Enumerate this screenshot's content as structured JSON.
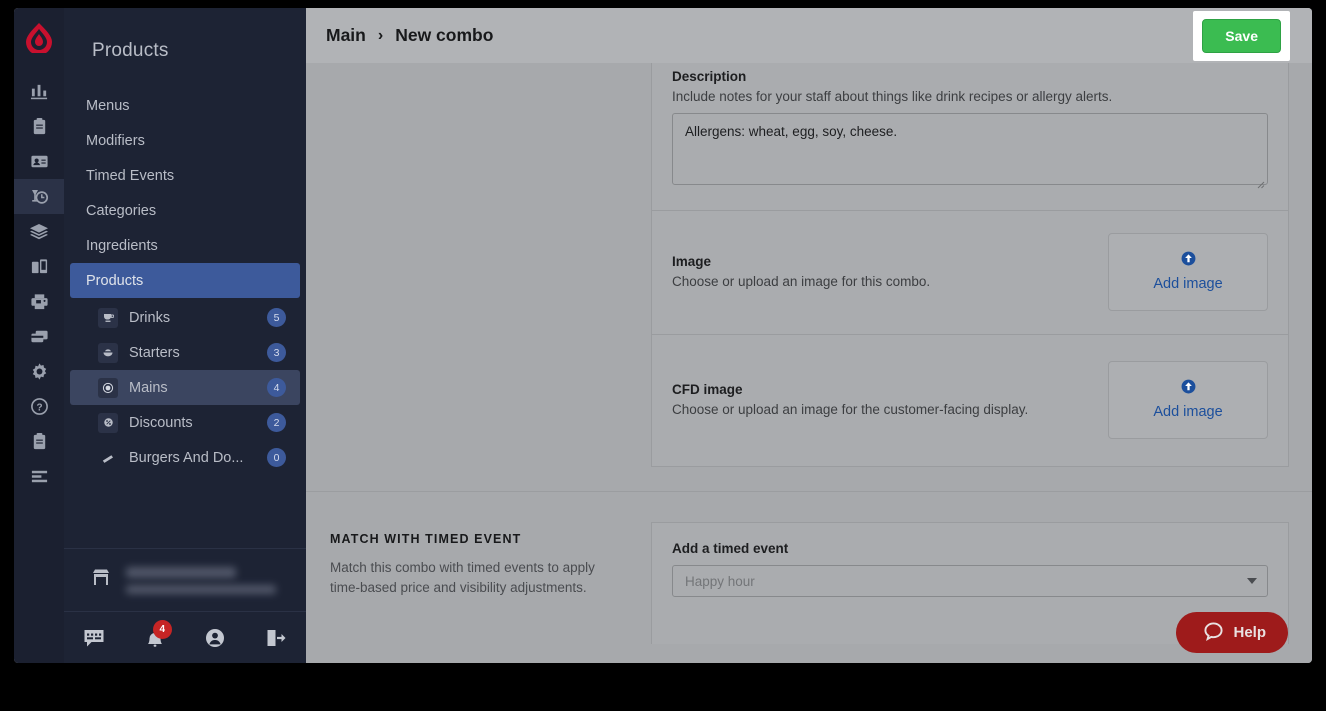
{
  "topbar": {
    "breadcrumb_root": "Main",
    "breadcrumb_sep": "›",
    "breadcrumb_current": "New combo",
    "save_label": "Save",
    "save_color": "#3bbc51"
  },
  "sidebar": {
    "title": "Products",
    "nav": [
      {
        "label": "Menus",
        "selected": false
      },
      {
        "label": "Modifiers",
        "selected": false
      },
      {
        "label": "Timed Events",
        "selected": false
      },
      {
        "label": "Categories",
        "selected": false
      },
      {
        "label": "Ingredients",
        "selected": false
      },
      {
        "label": "Products",
        "selected": true
      }
    ],
    "subnav": [
      {
        "label": "Drinks",
        "badge": "5",
        "icon": "drink-icon",
        "selected": false
      },
      {
        "label": "Starters",
        "badge": "3",
        "icon": "starter-icon",
        "selected": false
      },
      {
        "label": "Mains",
        "badge": "4",
        "icon": "mains-icon",
        "selected": true
      },
      {
        "label": "Discounts",
        "badge": "2",
        "icon": "discount-icon",
        "selected": false
      },
      {
        "label": "Burgers And Do...",
        "badge": "0",
        "icon": "burger-icon",
        "selected": false
      }
    ],
    "accent": "#3d5a9b",
    "bottom_icons": [
      {
        "name": "chat-icon",
        "badge": ""
      },
      {
        "name": "bell-icon",
        "badge": "4"
      },
      {
        "name": "account-icon",
        "badge": ""
      },
      {
        "name": "logout-icon",
        "badge": ""
      }
    ]
  },
  "rail": {
    "items": [
      "reports-icon",
      "clipboard-icon",
      "customers-icon",
      "products-icon",
      "stock-icon",
      "devices-icon",
      "printer-icon",
      "payments-icon",
      "settings-icon",
      "help-icon",
      "orders-icon",
      "list-icon"
    ],
    "active_index": 3
  },
  "form": {
    "description": {
      "title": "Description",
      "desc": "Include notes for your staff about things like drink recipes or allergy alerts.",
      "value": "Allergens: wheat, egg, soy, cheese."
    },
    "image": {
      "title": "Image",
      "desc": "Choose or upload an image for this combo.",
      "button_label": "Add image",
      "button_icon": "upload-circle-icon"
    },
    "cfd_image": {
      "title": "CFD image",
      "desc": "Choose or upload an image for the customer-facing display.",
      "button_label": "Add image",
      "button_icon": "upload-circle-icon"
    }
  },
  "timed_event": {
    "heading": "MATCH WITH TIMED EVENT",
    "description": "Match this combo with timed events to apply time-based price and visibility adjustments.",
    "field_label": "Add a timed event",
    "placeholder": "Happy hour"
  },
  "help_widget": {
    "label": "Help",
    "icon": "chat-bubble-icon",
    "color": "#9e1b1b"
  }
}
